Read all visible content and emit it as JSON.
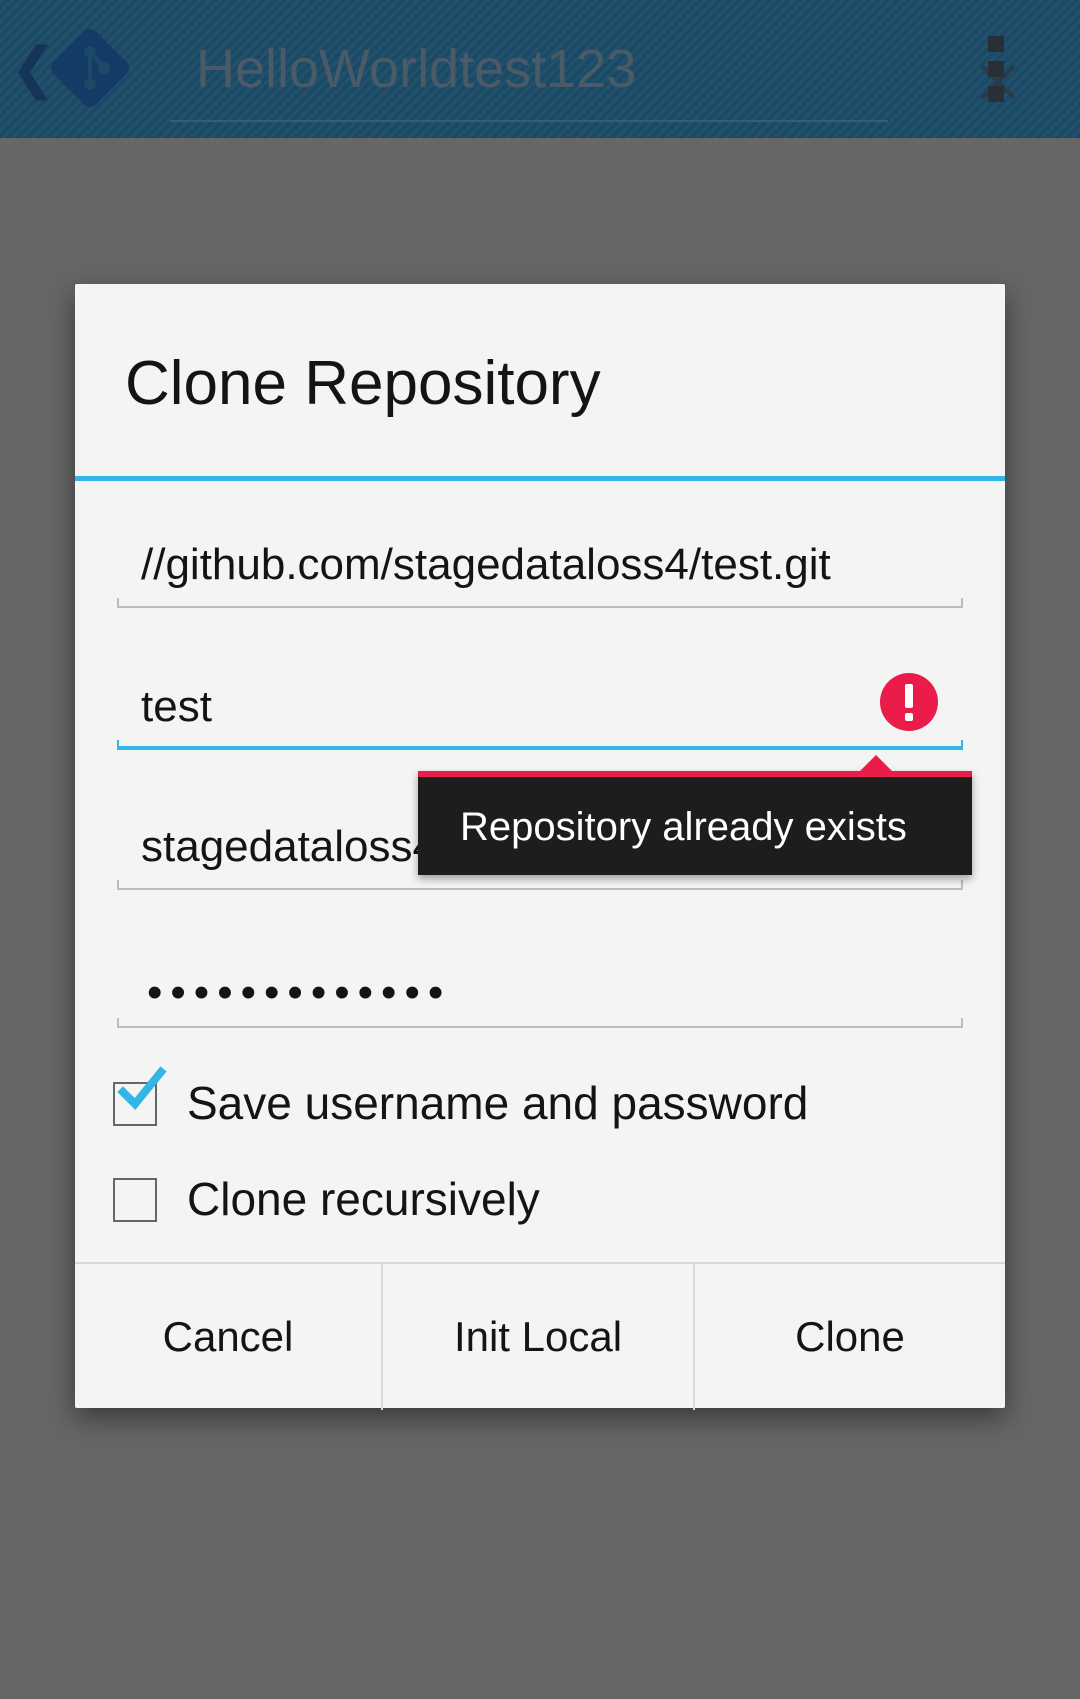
{
  "action_bar": {
    "search_text": "HelloWorldtest123",
    "icons": {
      "up": "chevron-left-icon",
      "logo": "git-logo-icon",
      "clear": "close-icon",
      "overflow": "overflow-menu-icon"
    },
    "colors": {
      "bar": "#1a4a66",
      "logo": "#143a66"
    }
  },
  "dialog": {
    "title": "Clone Repository",
    "fields": {
      "remote_url": "//github.com/stagedataloss4/test.git",
      "local_path": "test",
      "username": "stagedataloss4",
      "password_mask": "•••••••••••••"
    },
    "error": {
      "message": "Repository already exists",
      "icon": "error-exclamation-icon",
      "color": "#ea1d4a"
    },
    "checkboxes": [
      {
        "label": "Save username and password",
        "checked": true
      },
      {
        "label": "Clone recursively",
        "checked": false
      }
    ],
    "buttons": {
      "cancel": "Cancel",
      "init_local": "Init Local",
      "clone": "Clone"
    },
    "accent_color": "#33b5e5"
  }
}
